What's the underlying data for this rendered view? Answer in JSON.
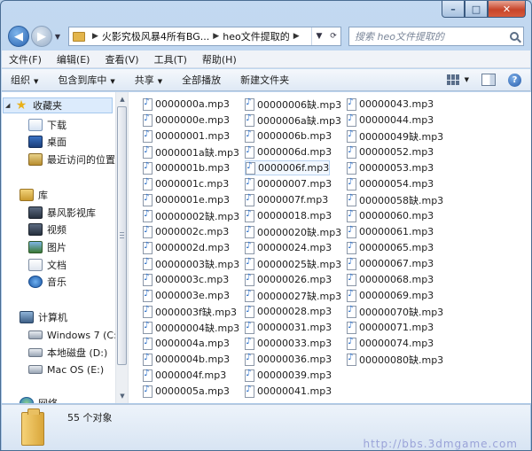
{
  "address": {
    "crumbs": [
      "火影究极风暴4所有BG...",
      "heo文件提取的"
    ],
    "search_placeholder": "搜索 heo文件提取的"
  },
  "menu": [
    "文件(F)",
    "编辑(E)",
    "查看(V)",
    "工具(T)",
    "帮助(H)"
  ],
  "toolbar": {
    "organize": "组织",
    "include": "包含到库中",
    "share": "共享",
    "play_all": "全部播放",
    "new_folder": "新建文件夹"
  },
  "nav": {
    "favorites": "收藏夹",
    "fav_items": [
      "下载",
      "桌面",
      "最近访问的位置"
    ],
    "libraries": "库",
    "lib_items": [
      "暴风影视库",
      "视频",
      "图片",
      "文档",
      "音乐"
    ],
    "computer": "计算机",
    "drives": [
      "Windows 7 (C:)",
      "本地磁盘 (D:)",
      "Mac OS (E:)"
    ],
    "network": "网络"
  },
  "files": {
    "col1": [
      "0000000a.mp3",
      "0000000e.mp3",
      "00000001.mp3",
      "0000001a缺.mp3",
      "0000001b.mp3",
      "0000001c.mp3",
      "0000001e.mp3",
      "00000002缺.mp3",
      "0000002c.mp3",
      "0000002d.mp3",
      "00000003缺.mp3",
      "0000003c.mp3",
      "0000003e.mp3",
      "0000003f缺.mp3",
      "00000004缺.mp3",
      "0000004a.mp3",
      "0000004b.mp3",
      "0000004f.mp3",
      "0000005a.mp3"
    ],
    "col2": [
      "00000006缺.mp3",
      "0000006a缺.mp3",
      "0000006b.mp3",
      "0000006d.mp3",
      "0000006f.mp3",
      "00000007.mp3",
      "0000007f.mp3",
      "00000018.mp3",
      "00000020缺.mp3",
      "00000024.mp3",
      "00000025缺.mp3",
      "00000026.mp3",
      "00000027缺.mp3",
      "00000028.mp3",
      "00000031.mp3",
      "00000033.mp3",
      "00000036.mp3",
      "00000039.mp3",
      "00000041.mp3"
    ],
    "col3": [
      "00000043.mp3",
      "00000044.mp3",
      "00000049缺.mp3",
      "00000052.mp3",
      "00000053.mp3",
      "00000054.mp3",
      "00000058缺.mp3",
      "00000060.mp3",
      "00000061.mp3",
      "00000065.mp3",
      "00000067.mp3",
      "00000068.mp3",
      "00000069.mp3",
      "00000070缺.mp3",
      "00000071.mp3",
      "00000074.mp3",
      "00000080缺.mp3"
    ]
  },
  "status": {
    "count": "55 个对象"
  },
  "watermark": "http://bbs.3dmgame.com"
}
